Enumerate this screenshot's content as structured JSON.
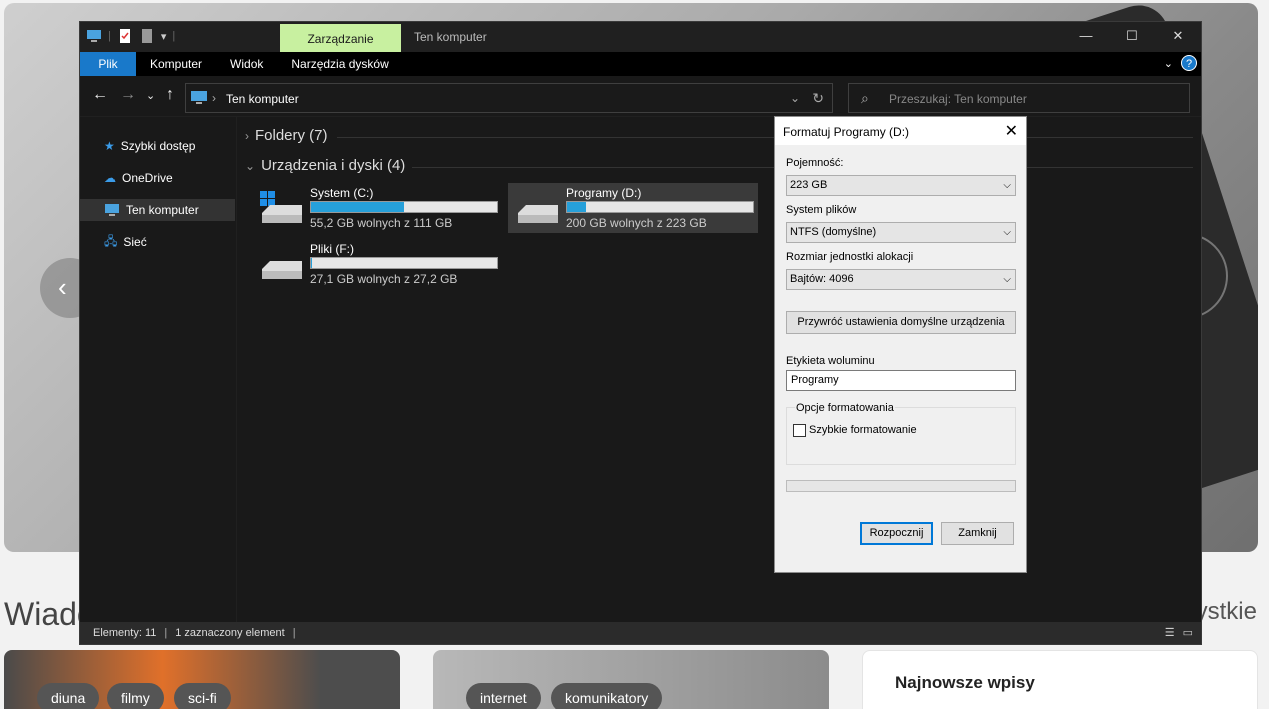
{
  "website": {
    "section_title": "Wiado",
    "see_all": "ystkie",
    "tags_card1": [
      "diuna",
      "filmy",
      "sci-fi"
    ],
    "tags_card2": [
      "internet",
      "komunikatory"
    ],
    "latest_title": "Najnowsze wpisy"
  },
  "explorer": {
    "context_tab": "Zarządzanie",
    "window_title": "Ten komputer",
    "ribbon_tabs": [
      "Plik",
      "Komputer",
      "Widok",
      "Narzędzia dysków"
    ],
    "breadcrumb": "Ten komputer",
    "search_placeholder": "Przeszukaj: Ten komputer",
    "sidebar": [
      {
        "label": "Szybki dostęp",
        "icon": "star-icon"
      },
      {
        "label": "OneDrive",
        "icon": "cloud-icon"
      },
      {
        "label": "Ten komputer",
        "icon": "computer-icon"
      },
      {
        "label": "Sieć",
        "icon": "network-icon"
      }
    ],
    "groups": {
      "folders": "Foldery (7)",
      "devices": "Urządzenia i dyski (4)"
    },
    "drives": [
      {
        "name": "System (C:)",
        "free": "55,2 GB wolnych z 111 GB",
        "used_fraction": 0.5
      },
      {
        "name": "Programy (D:)",
        "free": "200 GB wolnych z 223 GB",
        "used_fraction": 0.1
      },
      {
        "name": "Pliki (F:)",
        "free": "27,1 GB wolnych z 27,2 GB",
        "used_fraction": 0.004
      }
    ],
    "status": {
      "elements": "Elementy: 11",
      "selected": "1 zaznaczony element"
    }
  },
  "dialog": {
    "title": "Formatuj Programy (D:)",
    "capacity_label": "Pojemność:",
    "capacity_value": "223 GB",
    "fs_label": "System plików",
    "fs_value": "NTFS (domyślne)",
    "alloc_label": "Rozmiar jednostki alokacji",
    "alloc_value": "Bajtów: 4096",
    "restore_button": "Przywróć ustawienia domyślne urządzenia",
    "volume_label": "Etykieta woluminu",
    "volume_value": "Programy",
    "options_label": "Opcje formatowania",
    "quick_format": "Szybkie formatowanie",
    "start_button": "Rozpocznij",
    "close_button": "Zamknij"
  }
}
